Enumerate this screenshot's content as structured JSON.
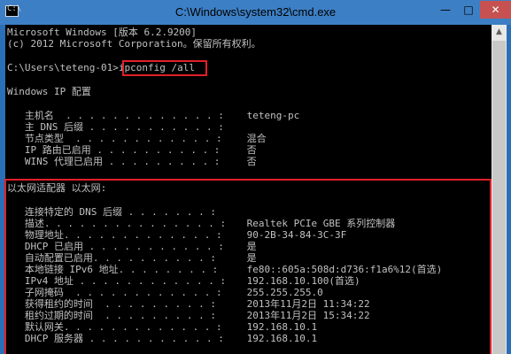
{
  "window": {
    "title": "C:\\Windows\\system32\\cmd.exe",
    "icon_label": "C:\\",
    "controls": {
      "minimize": "—",
      "maximize": "□",
      "close": "✕"
    }
  },
  "console": {
    "banner": "Microsoft Windows [版本 6.2.9200]",
    "copyright": "(c) 2012 Microsoft Corporation。保留所有权利。",
    "prompt": "C:\\Users\\teteng-01>",
    "command": "ipconfig /all",
    "section_ip": "Windows IP 配置",
    "ip_config": [
      {
        "key": "   主机名  . . . . . . . . . . . . . :",
        "value": " teteng-pc"
      },
      {
        "key": "   主 DNS 后缀 . . . . . . . . . . . :",
        "value": ""
      },
      {
        "key": "   节点类型  . . . . . . . . . . . . :",
        "value": " 混合"
      },
      {
        "key": "   IP 路由已启用 . . . . . . . . . . :",
        "value": " 否"
      },
      {
        "key": "   WINS 代理已启用 . . . . . . . . . :",
        "value": " 否"
      }
    ],
    "section_adapter": "以太网适配器 以太网:",
    "adapter": [
      {
        "key": "   连接特定的 DNS 后缀 . . . . . . . :",
        "value": ""
      },
      {
        "key": "   描述. . . . . . . . . . . . . . . :",
        "value": " Realtek PCIe GBE 系列控制器"
      },
      {
        "key": "   物理地址. . . . . . . . . . . . . :",
        "value": " 90-2B-34-84-3C-3F"
      },
      {
        "key": "   DHCP 已启用 . . . . . . . . . . . :",
        "value": " 是"
      },
      {
        "key": "   自动配置已启用. . . . . . . . . . :",
        "value": " 是"
      },
      {
        "key": "   本地链接 IPv6 地址. . . . . . . . :",
        "value": " fe80::605a:508d:d736:f1a6%12(首选)"
      },
      {
        "key": "   IPv4 地址 . . . . . . . . . . . . :",
        "value": " 192.168.10.100(首选)"
      },
      {
        "key": "   子网掩码  . . . . . . . . . . . . :",
        "value": " 255.255.255.0"
      },
      {
        "key": "   获得租约的时间  . . . . . . . . . :",
        "value": " 2013年11月2日 11:34:22"
      },
      {
        "key": "   租约过期的时间  . . . . . . . . . :",
        "value": " 2013年11月2日 15:34:22"
      },
      {
        "key": "   默认网关. . . . . . . . . . . . . :",
        "value": " 192.168.10.1"
      },
      {
        "key": "   DHCP 服务器 . . . . . . . . . . . :",
        "value": " 192.168.10.1"
      }
    ]
  },
  "colors": {
    "console_bg": "#000000",
    "console_text": "#c0c0c0",
    "titlebar": "#3d7fc4",
    "highlight_box": "#e0202a"
  }
}
